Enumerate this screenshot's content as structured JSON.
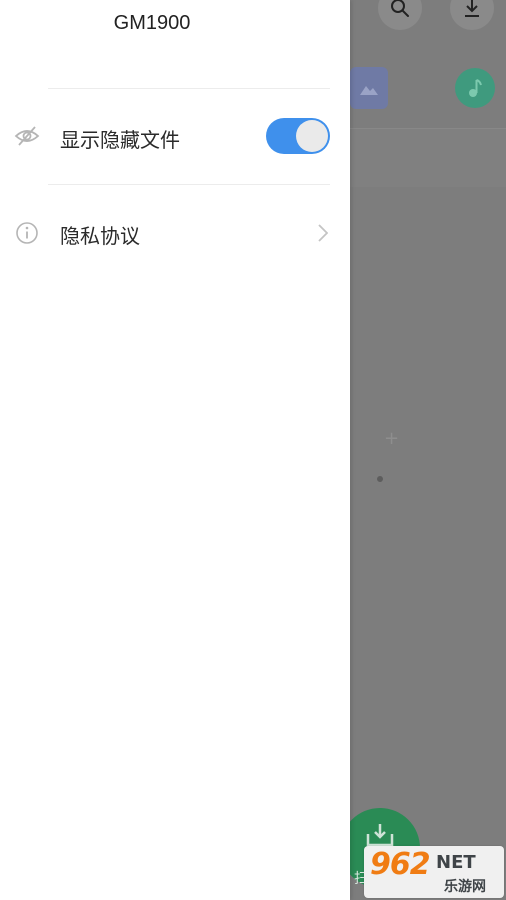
{
  "drawer": {
    "device_name": "GM1900",
    "items": [
      {
        "label": "显示隐藏文件",
        "icon": "eye-hidden-icon",
        "control": "toggle",
        "toggle_on": true
      },
      {
        "label": "隐私协议",
        "icon": "info-icon",
        "control": "chevron"
      }
    ]
  },
  "background": {
    "fab_label": "扫",
    "plus_glyph": "+"
  },
  "watermark": {
    "number": "962",
    "net": "NET",
    "cn": "乐游网"
  },
  "colors": {
    "toggle_on": "#3f90ec",
    "scrim": "#7d7d7d",
    "fab": "#2a8b55",
    "watermark_orange": "#f07c13"
  }
}
